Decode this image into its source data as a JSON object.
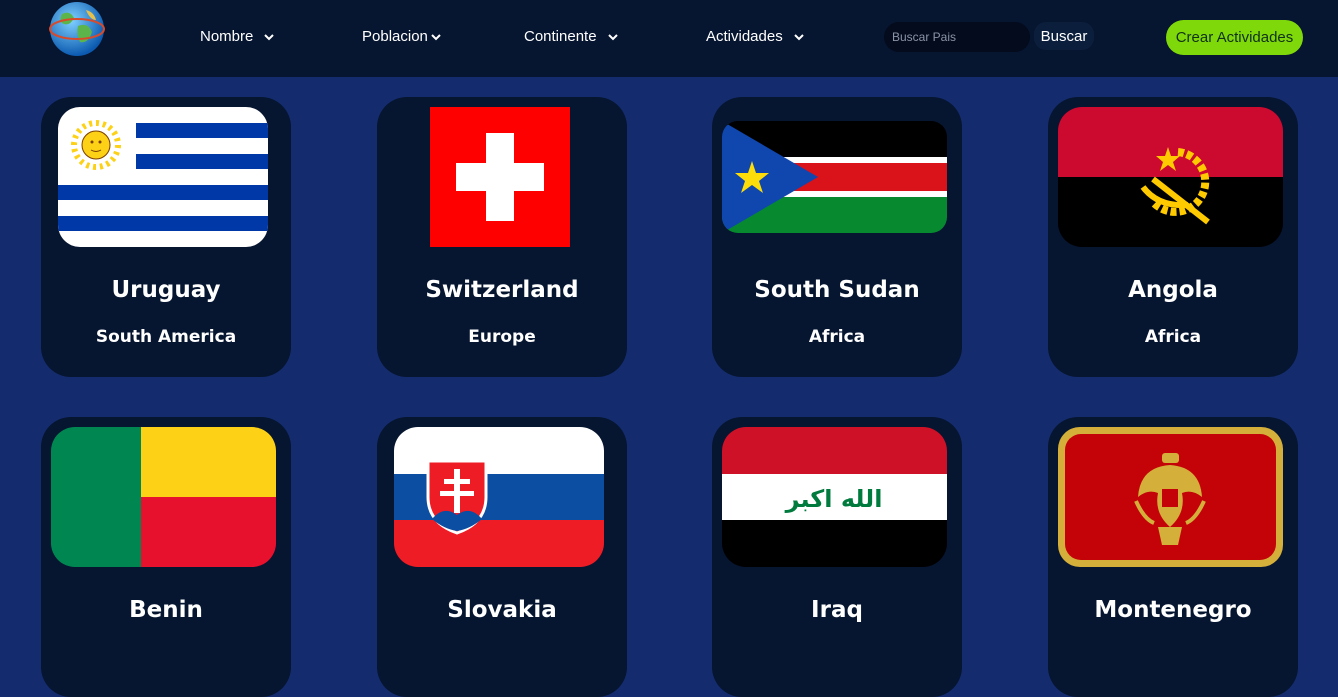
{
  "nav": {
    "logo_icon": "globe-icon",
    "filters": [
      {
        "label": "Nombre"
      },
      {
        "label": "Poblacion"
      },
      {
        "label": "Continente"
      },
      {
        "label": "Actividades"
      }
    ],
    "search_placeholder": "Buscar Pais",
    "search_button": "Buscar",
    "create_button": "Crear Actividades"
  },
  "countries": [
    {
      "name": "Uruguay",
      "continent": "South America",
      "flag_icon": "uruguay-flag-icon"
    },
    {
      "name": "Switzerland",
      "continent": "Europe",
      "flag_icon": "switzerland-flag-icon"
    },
    {
      "name": "South Sudan",
      "continent": "Africa",
      "flag_icon": "south-sudan-flag-icon"
    },
    {
      "name": "Angola",
      "continent": "Africa",
      "flag_icon": "angola-flag-icon"
    },
    {
      "name": "Benin",
      "continent": "",
      "flag_icon": "benin-flag-icon"
    },
    {
      "name": "Slovakia",
      "continent": "",
      "flag_icon": "slovakia-flag-icon"
    },
    {
      "name": "Iraq",
      "continent": "",
      "flag_icon": "iraq-flag-icon"
    },
    {
      "name": "Montenegro",
      "continent": "",
      "flag_icon": "montenegro-flag-icon"
    }
  ],
  "iraq_flag_text": "الله اكبر",
  "colors": {
    "page_bg": "#142c6e",
    "navbar_bg": "#061530",
    "card_bg": "#061530",
    "create_button_bg": "#7fd90a"
  }
}
